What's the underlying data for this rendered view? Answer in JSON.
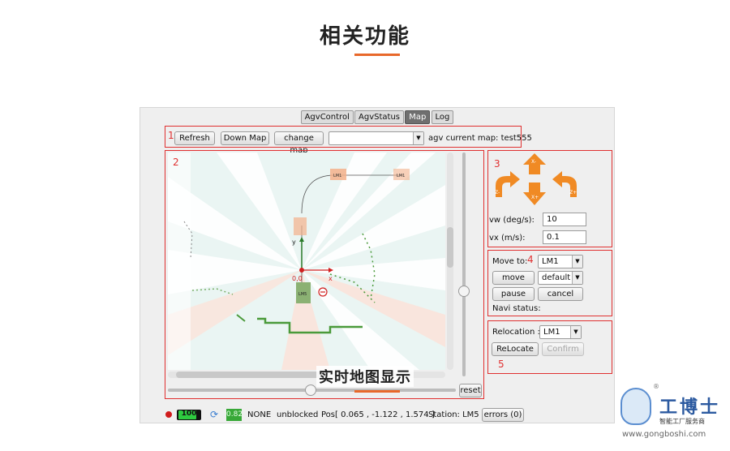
{
  "slide": {
    "title": "相关功能",
    "accent_color": "#e8682a"
  },
  "tabs": [
    {
      "label": "AgvControl",
      "active": false
    },
    {
      "label": "AgvStatus",
      "active": false
    },
    {
      "label": "Map",
      "active": true
    },
    {
      "label": "Log",
      "active": false
    }
  ],
  "toolbar": {
    "section_number": "1",
    "refresh_label": "Refresh",
    "down_map_label": "Down Map",
    "change_map_label": "change map",
    "map_select_value": "",
    "current_map_text": "agv current map: test555"
  },
  "map": {
    "section_number": "2",
    "axis_y_label": "y",
    "axis_x_label": "x",
    "origin_label": "0,0",
    "station_labels": [
      "LM1",
      "LM1",
      "LM5"
    ],
    "reset_label": "reset",
    "caption": "实时地图显示"
  },
  "manual": {
    "section_number": "3",
    "arrows": {
      "up": "X-",
      "down": "X+",
      "left": "Z-",
      "right": "Z+"
    },
    "vw_label": "vw (deg/s):",
    "vw_value": "10",
    "vx_label": "vx (m/s):",
    "vx_value": "0.1"
  },
  "move": {
    "section_number": "4",
    "move_to_label": "Move to:",
    "target_value": "LM1",
    "move_label": "move",
    "mode_value": "default",
    "pause_label": "pause",
    "cancel_label": "cancel",
    "navi_status_label": "Navi status:"
  },
  "relocation": {
    "section_number": "5",
    "label": "Relocation :",
    "value": "LM1",
    "relocate_label": "ReLocate",
    "confirm_label": "Confirm"
  },
  "status_bar": {
    "battery": "100",
    "speed": "0.82",
    "mode": "NONE",
    "blocked": "unblocked",
    "pos": "Pos[ 0.065 , -1.122 , 1.574 ]",
    "station": "Station: LM5",
    "errors": "errors (0)"
  },
  "logo": {
    "name": "工博士",
    "subtitle": "智能工厂服务商",
    "url": "www.gongboshi.com",
    "reg_mark": "®"
  },
  "icons": [
    "sync-icon",
    "record-dot-icon",
    "battery-icon",
    "dropdown-arrow-icon",
    "arrow-up-icon",
    "arrow-down-icon",
    "turn-left-icon",
    "turn-right-icon",
    "robot-mascot-icon"
  ]
}
